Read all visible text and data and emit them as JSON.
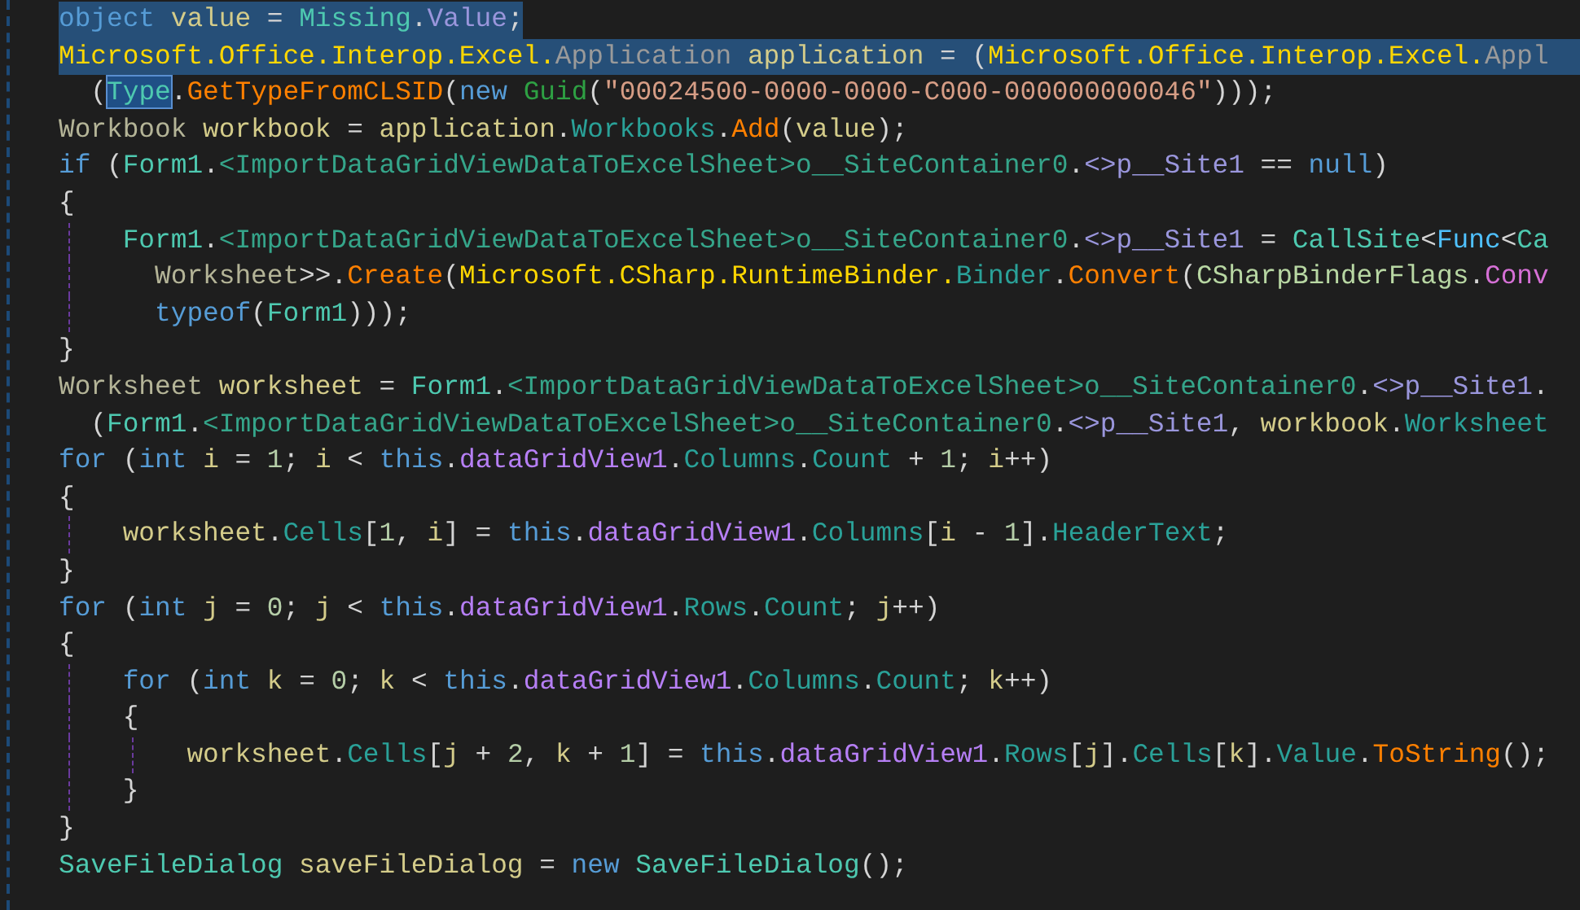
{
  "editor": {
    "lines": [
      {
        "selected": true,
        "eol_selected": false,
        "tokens": [
          {
            "kind": "k",
            "text": "object "
          },
          {
            "kind": "v",
            "text": "value"
          },
          {
            "kind": "pu",
            "text": " = "
          },
          {
            "kind": "t",
            "text": "Missing"
          },
          {
            "kind": "pu",
            "text": "."
          },
          {
            "kind": "si",
            "text": "Value"
          },
          {
            "kind": "pu",
            "text": ";"
          }
        ]
      },
      {
        "selected": true,
        "eol_selected": true,
        "tokens": [
          {
            "kind": "ns",
            "text": "Microsoft.Office.Interop.Excel."
          },
          {
            "kind": "g",
            "text": "Application "
          },
          {
            "kind": "v",
            "text": "application"
          },
          {
            "kind": "pu",
            "text": " = ("
          },
          {
            "kind": "ns",
            "text": "Microsoft.Office.Interop.Excel."
          },
          {
            "kind": "g",
            "text": "Appl"
          }
        ]
      },
      {
        "selected": false,
        "eol_selected": false,
        "tokens": [
          {
            "kind": "pu",
            "text": "  ("
          },
          {
            "kind": "match",
            "text": "Type"
          },
          {
            "kind": "pu",
            "text": "."
          },
          {
            "kind": "m",
            "text": "GetTypeFromCLSID"
          },
          {
            "kind": "pu",
            "text": "("
          },
          {
            "kind": "k",
            "text": "new "
          },
          {
            "kind": "gr",
            "text": "Guid"
          },
          {
            "kind": "pu",
            "text": "("
          },
          {
            "kind": "s",
            "text": "\"00024500-0000-0000-C000-000000000046\""
          },
          {
            "kind": "pu",
            "text": ")));"
          }
        ]
      },
      {
        "selected": false,
        "eol_selected": false,
        "tokens": [
          {
            "kind": "tg",
            "text": "Workbook "
          },
          {
            "kind": "v",
            "text": "workbook"
          },
          {
            "kind": "pu",
            "text": " = "
          },
          {
            "kind": "v",
            "text": "application"
          },
          {
            "kind": "pu",
            "text": "."
          },
          {
            "kind": "p",
            "text": "Workbooks"
          },
          {
            "kind": "pu",
            "text": "."
          },
          {
            "kind": "m",
            "text": "Add"
          },
          {
            "kind": "pu",
            "text": "("
          },
          {
            "kind": "v",
            "text": "value"
          },
          {
            "kind": "pu",
            "text": ");"
          }
        ]
      },
      {
        "selected": false,
        "eol_selected": false,
        "tokens": [
          {
            "kind": "k",
            "text": "if"
          },
          {
            "kind": "pu",
            "text": " ("
          },
          {
            "kind": "t",
            "text": "Form1"
          },
          {
            "kind": "pu",
            "text": "."
          },
          {
            "kind": "sc",
            "text": "<ImportDataGridViewDataToExcelSheet>o__SiteContainer0"
          },
          {
            "kind": "pu",
            "text": "."
          },
          {
            "kind": "si",
            "text": "<>p__Site1"
          },
          {
            "kind": "pu",
            "text": " == "
          },
          {
            "kind": "k",
            "text": "null"
          },
          {
            "kind": "pu",
            "text": ")"
          }
        ]
      },
      {
        "selected": false,
        "eol_selected": false,
        "tokens": [
          {
            "kind": "pu",
            "text": "{"
          }
        ]
      },
      {
        "selected": false,
        "eol_selected": false,
        "tokens": [
          {
            "kind": "t",
            "text": "    Form1"
          },
          {
            "kind": "pu",
            "text": "."
          },
          {
            "kind": "sc",
            "text": "<ImportDataGridViewDataToExcelSheet>o__SiteContainer0"
          },
          {
            "kind": "pu",
            "text": "."
          },
          {
            "kind": "si",
            "text": "<>p__Site1"
          },
          {
            "kind": "pu",
            "text": " = "
          },
          {
            "kind": "t",
            "text": "CallSite"
          },
          {
            "kind": "pu",
            "text": "<"
          },
          {
            "kind": "de",
            "text": "Func"
          },
          {
            "kind": "pu",
            "text": "<"
          },
          {
            "kind": "t",
            "text": "Ca"
          }
        ]
      },
      {
        "selected": false,
        "eol_selected": false,
        "tokens": [
          {
            "kind": "tg",
            "text": "      Worksheet"
          },
          {
            "kind": "pu",
            "text": ">>."
          },
          {
            "kind": "m",
            "text": "Create"
          },
          {
            "kind": "pu",
            "text": "("
          },
          {
            "kind": "ns",
            "text": "Microsoft.CSharp.RuntimeBinder."
          },
          {
            "kind": "p",
            "text": "Binder"
          },
          {
            "kind": "pu",
            "text": "."
          },
          {
            "kind": "m",
            "text": "Convert"
          },
          {
            "kind": "pu",
            "text": "("
          },
          {
            "kind": "fl",
            "text": "CSharpBinderFlags"
          },
          {
            "kind": "pu",
            "text": "."
          },
          {
            "kind": "en",
            "text": "Conv"
          }
        ]
      },
      {
        "selected": false,
        "eol_selected": false,
        "tokens": [
          {
            "kind": "k",
            "text": "      typeof"
          },
          {
            "kind": "pu",
            "text": "("
          },
          {
            "kind": "t",
            "text": "Form1"
          },
          {
            "kind": "pu",
            "text": ")));"
          }
        ]
      },
      {
        "selected": false,
        "eol_selected": false,
        "tokens": [
          {
            "kind": "pu",
            "text": "}"
          }
        ]
      },
      {
        "selected": false,
        "eol_selected": false,
        "tokens": [
          {
            "kind": "tg",
            "text": "Worksheet "
          },
          {
            "kind": "v",
            "text": "worksheet"
          },
          {
            "kind": "pu",
            "text": " = "
          },
          {
            "kind": "t",
            "text": "Form1"
          },
          {
            "kind": "pu",
            "text": "."
          },
          {
            "kind": "sc",
            "text": "<ImportDataGridViewDataToExcelSheet>o__SiteContainer0"
          },
          {
            "kind": "pu",
            "text": "."
          },
          {
            "kind": "si",
            "text": "<>p__Site1"
          },
          {
            "kind": "pu",
            "text": "."
          }
        ]
      },
      {
        "selected": false,
        "eol_selected": false,
        "tokens": [
          {
            "kind": "pu",
            "text": "  ("
          },
          {
            "kind": "t",
            "text": "Form1"
          },
          {
            "kind": "pu",
            "text": "."
          },
          {
            "kind": "sc",
            "text": "<ImportDataGridViewDataToExcelSheet>o__SiteContainer0"
          },
          {
            "kind": "pu",
            "text": "."
          },
          {
            "kind": "si",
            "text": "<>p__Site1"
          },
          {
            "kind": "pu",
            "text": ", "
          },
          {
            "kind": "v",
            "text": "workbook"
          },
          {
            "kind": "pu",
            "text": "."
          },
          {
            "kind": "p",
            "text": "Worksheet"
          }
        ]
      },
      {
        "selected": false,
        "eol_selected": false,
        "tokens": [
          {
            "kind": "k",
            "text": "for"
          },
          {
            "kind": "pu",
            "text": " ("
          },
          {
            "kind": "k",
            "text": "int "
          },
          {
            "kind": "v",
            "text": "i"
          },
          {
            "kind": "pu",
            "text": " = "
          },
          {
            "kind": "n",
            "text": "1"
          },
          {
            "kind": "pu",
            "text": "; "
          },
          {
            "kind": "v",
            "text": "i"
          },
          {
            "kind": "pu",
            "text": " < "
          },
          {
            "kind": "k",
            "text": "this"
          },
          {
            "kind": "pu",
            "text": "."
          },
          {
            "kind": "f",
            "text": "dataGridView1"
          },
          {
            "kind": "pu",
            "text": "."
          },
          {
            "kind": "p",
            "text": "Columns"
          },
          {
            "kind": "pu",
            "text": "."
          },
          {
            "kind": "p",
            "text": "Count"
          },
          {
            "kind": "pu",
            "text": " + "
          },
          {
            "kind": "n",
            "text": "1"
          },
          {
            "kind": "pu",
            "text": "; "
          },
          {
            "kind": "v",
            "text": "i"
          },
          {
            "kind": "pu",
            "text": "++)"
          }
        ]
      },
      {
        "selected": false,
        "eol_selected": false,
        "tokens": [
          {
            "kind": "pu",
            "text": "{"
          }
        ]
      },
      {
        "selected": false,
        "eol_selected": false,
        "tokens": [
          {
            "kind": "v",
            "text": "    worksheet"
          },
          {
            "kind": "pu",
            "text": "."
          },
          {
            "kind": "p",
            "text": "Cells"
          },
          {
            "kind": "pu",
            "text": "["
          },
          {
            "kind": "n",
            "text": "1"
          },
          {
            "kind": "pu",
            "text": ", "
          },
          {
            "kind": "v",
            "text": "i"
          },
          {
            "kind": "pu",
            "text": "] = "
          },
          {
            "kind": "k",
            "text": "this"
          },
          {
            "kind": "pu",
            "text": "."
          },
          {
            "kind": "f",
            "text": "dataGridView1"
          },
          {
            "kind": "pu",
            "text": "."
          },
          {
            "kind": "p",
            "text": "Columns"
          },
          {
            "kind": "pu",
            "text": "["
          },
          {
            "kind": "v",
            "text": "i"
          },
          {
            "kind": "pu",
            "text": " - "
          },
          {
            "kind": "n",
            "text": "1"
          },
          {
            "kind": "pu",
            "text": "]."
          },
          {
            "kind": "p",
            "text": "HeaderText"
          },
          {
            "kind": "pu",
            "text": ";"
          }
        ]
      },
      {
        "selected": false,
        "eol_selected": false,
        "tokens": [
          {
            "kind": "pu",
            "text": "}"
          }
        ]
      },
      {
        "selected": false,
        "eol_selected": false,
        "tokens": [
          {
            "kind": "k",
            "text": "for"
          },
          {
            "kind": "pu",
            "text": " ("
          },
          {
            "kind": "k",
            "text": "int "
          },
          {
            "kind": "v",
            "text": "j"
          },
          {
            "kind": "pu",
            "text": " = "
          },
          {
            "kind": "n",
            "text": "0"
          },
          {
            "kind": "pu",
            "text": "; "
          },
          {
            "kind": "v",
            "text": "j"
          },
          {
            "kind": "pu",
            "text": " < "
          },
          {
            "kind": "k",
            "text": "this"
          },
          {
            "kind": "pu",
            "text": "."
          },
          {
            "kind": "f",
            "text": "dataGridView1"
          },
          {
            "kind": "pu",
            "text": "."
          },
          {
            "kind": "p",
            "text": "Rows"
          },
          {
            "kind": "pu",
            "text": "."
          },
          {
            "kind": "p",
            "text": "Count"
          },
          {
            "kind": "pu",
            "text": "; "
          },
          {
            "kind": "v",
            "text": "j"
          },
          {
            "kind": "pu",
            "text": "++)"
          }
        ]
      },
      {
        "selected": false,
        "eol_selected": false,
        "tokens": [
          {
            "kind": "pu",
            "text": "{"
          }
        ]
      },
      {
        "selected": false,
        "eol_selected": false,
        "tokens": [
          {
            "kind": "k",
            "text": "    for"
          },
          {
            "kind": "pu",
            "text": " ("
          },
          {
            "kind": "k",
            "text": "int "
          },
          {
            "kind": "v",
            "text": "k"
          },
          {
            "kind": "pu",
            "text": " = "
          },
          {
            "kind": "n",
            "text": "0"
          },
          {
            "kind": "pu",
            "text": "; "
          },
          {
            "kind": "v",
            "text": "k"
          },
          {
            "kind": "pu",
            "text": " < "
          },
          {
            "kind": "k",
            "text": "this"
          },
          {
            "kind": "pu",
            "text": "."
          },
          {
            "kind": "f",
            "text": "dataGridView1"
          },
          {
            "kind": "pu",
            "text": "."
          },
          {
            "kind": "p",
            "text": "Columns"
          },
          {
            "kind": "pu",
            "text": "."
          },
          {
            "kind": "p",
            "text": "Count"
          },
          {
            "kind": "pu",
            "text": "; "
          },
          {
            "kind": "v",
            "text": "k"
          },
          {
            "kind": "pu",
            "text": "++)"
          }
        ]
      },
      {
        "selected": false,
        "eol_selected": false,
        "tokens": [
          {
            "kind": "pu",
            "text": "    {"
          }
        ]
      },
      {
        "selected": false,
        "eol_selected": false,
        "tokens": [
          {
            "kind": "v",
            "text": "        worksheet"
          },
          {
            "kind": "pu",
            "text": "."
          },
          {
            "kind": "p",
            "text": "Cells"
          },
          {
            "kind": "pu",
            "text": "["
          },
          {
            "kind": "v",
            "text": "j"
          },
          {
            "kind": "pu",
            "text": " + "
          },
          {
            "kind": "n",
            "text": "2"
          },
          {
            "kind": "pu",
            "text": ", "
          },
          {
            "kind": "v",
            "text": "k"
          },
          {
            "kind": "pu",
            "text": " + "
          },
          {
            "kind": "n",
            "text": "1"
          },
          {
            "kind": "pu",
            "text": "] = "
          },
          {
            "kind": "k",
            "text": "this"
          },
          {
            "kind": "pu",
            "text": "."
          },
          {
            "kind": "f",
            "text": "dataGridView1"
          },
          {
            "kind": "pu",
            "text": "."
          },
          {
            "kind": "p",
            "text": "Rows"
          },
          {
            "kind": "pu",
            "text": "["
          },
          {
            "kind": "v",
            "text": "j"
          },
          {
            "kind": "pu",
            "text": "]."
          },
          {
            "kind": "p",
            "text": "Cells"
          },
          {
            "kind": "pu",
            "text": "["
          },
          {
            "kind": "v",
            "text": "k"
          },
          {
            "kind": "pu",
            "text": "]."
          },
          {
            "kind": "p",
            "text": "Value"
          },
          {
            "kind": "pu",
            "text": "."
          },
          {
            "kind": "m",
            "text": "ToString"
          },
          {
            "kind": "pu",
            "text": "();"
          }
        ]
      },
      {
        "selected": false,
        "eol_selected": false,
        "tokens": [
          {
            "kind": "pu",
            "text": "    }"
          }
        ]
      },
      {
        "selected": false,
        "eol_selected": false,
        "tokens": [
          {
            "kind": "pu",
            "text": "}"
          }
        ]
      },
      {
        "selected": false,
        "eol_selected": false,
        "tokens": [
          {
            "kind": "t",
            "text": "SaveFileDialog "
          },
          {
            "kind": "v",
            "text": "saveFileDialog"
          },
          {
            "kind": "pu",
            "text": " = "
          },
          {
            "kind": "k",
            "text": "new "
          },
          {
            "kind": "t",
            "text": "SaveFileDialog"
          },
          {
            "kind": "pu",
            "text": "();"
          }
        ]
      }
    ]
  }
}
